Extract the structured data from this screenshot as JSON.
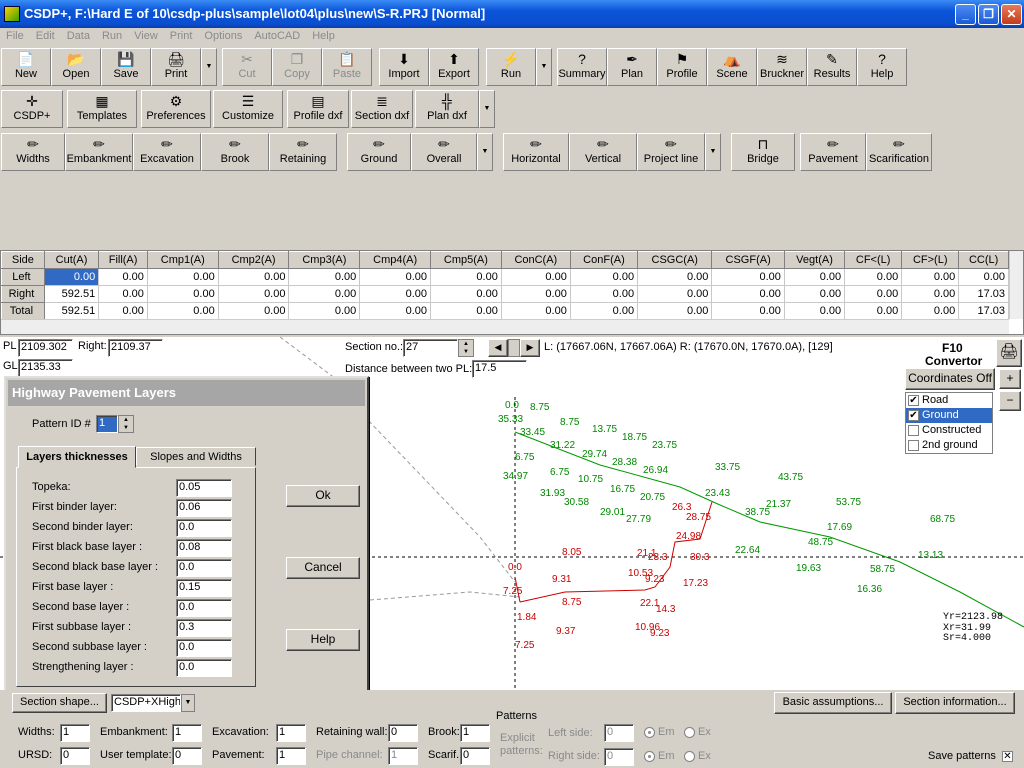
{
  "window": {
    "title": "CSDP+, F:\\Hard E of 10\\csdp-plus\\sample\\lot04\\plus\\new\\S-R.PRJ [Normal]"
  },
  "menu": [
    "File",
    "Edit",
    "Data",
    "Run",
    "View",
    "Print",
    "Options",
    "AutoCAD",
    "Help"
  ],
  "toolbar1": [
    {
      "label": "New",
      "icon": "📄"
    },
    {
      "label": "Open",
      "icon": "📂"
    },
    {
      "label": "Save",
      "icon": "💾"
    },
    {
      "label": "Print",
      "icon": "🖨"
    },
    {
      "label": "Cut",
      "icon": "✂"
    },
    {
      "label": "Copy",
      "icon": "❐"
    },
    {
      "label": "Paste",
      "icon": "📋"
    },
    {
      "label": "Import",
      "icon": "⬇"
    },
    {
      "label": "Export",
      "icon": "⬆"
    },
    {
      "label": "Run",
      "icon": "⚡"
    },
    {
      "label": "Summary",
      "icon": "?"
    },
    {
      "label": "Plan",
      "icon": "✒"
    },
    {
      "label": "Profile",
      "icon": "⚑"
    },
    {
      "label": "Scene",
      "icon": "⛺"
    },
    {
      "label": "Bruckner",
      "icon": "≋"
    },
    {
      "label": "Results",
      "icon": "✎"
    },
    {
      "label": "Help",
      "icon": "?"
    }
  ],
  "toolbar2": [
    {
      "label": "CSDP+",
      "icon": "✛"
    },
    {
      "label": "Templates",
      "icon": "▦"
    },
    {
      "label": "Preferences",
      "icon": "⚙"
    },
    {
      "label": "Customize",
      "icon": "☰"
    },
    {
      "label": "Profile dxf",
      "icon": "▤"
    },
    {
      "label": "Section dxf",
      "icon": "≣"
    },
    {
      "label": "Plan dxf",
      "icon": "╬"
    }
  ],
  "toolbar3": [
    {
      "label": "Widths",
      "icon": "✏"
    },
    {
      "label": "Embankment",
      "icon": "✏"
    },
    {
      "label": "Excavation",
      "icon": "✏"
    },
    {
      "label": "Brook",
      "icon": "✏"
    },
    {
      "label": "Retaining",
      "icon": "✏"
    },
    {
      "label": "Ground",
      "icon": "✏"
    },
    {
      "label": "Overall",
      "icon": "✏"
    },
    {
      "label": "Horizontal",
      "icon": "✏"
    },
    {
      "label": "Vertical",
      "icon": "✏"
    },
    {
      "label": "Project line",
      "icon": "✏"
    },
    {
      "label": "Bridge",
      "icon": "⊓"
    },
    {
      "label": "Pavement",
      "icon": "✏"
    },
    {
      "label": "Scarification",
      "icon": "✏"
    }
  ],
  "grid": {
    "headers": [
      "Side",
      "Cut(A)",
      "Fill(A)",
      "Cmp1(A)",
      "Cmp2(A)",
      "Cmp3(A)",
      "Cmp4(A)",
      "Cmp5(A)",
      "ConC(A)",
      "ConF(A)",
      "CSGC(A)",
      "CSGF(A)",
      "Vegt(A)",
      "CF<(L)",
      "CF>(L)",
      "CC(L)"
    ],
    "rows": [
      [
        "Left",
        "0.00",
        "0.00",
        "0.00",
        "0.00",
        "0.00",
        "0.00",
        "0.00",
        "0.00",
        "0.00",
        "0.00",
        "0.00",
        "0.00",
        "0.00",
        "0.00",
        "0.00"
      ],
      [
        "Right",
        "592.51",
        "0.00",
        "0.00",
        "0.00",
        "0.00",
        "0.00",
        "0.00",
        "0.00",
        "0.00",
        "0.00",
        "0.00",
        "0.00",
        "0.00",
        "0.00",
        "17.03"
      ],
      [
        "Total",
        "592.51",
        "0.00",
        "0.00",
        "0.00",
        "0.00",
        "0.00",
        "0.00",
        "0.00",
        "0.00",
        "0.00",
        "0.00",
        "0.00",
        "0.00",
        "0.00",
        "17.03"
      ]
    ]
  },
  "section": {
    "pl_label": "PL",
    "pl_value": "2109.302",
    "right_label": "Right:",
    "right_value": "2109.37",
    "gl_label": "GL",
    "gl_value": "2135.33",
    "section_no_label": "Section no.:",
    "section_no": "27",
    "dist_label": "Distance between two PL:",
    "dist_value": "17.5",
    "coords": "L: (17667.06N, 17667.06A) R: (17670.0N, 17670.0A), [129]",
    "f10": "F10",
    "convertor": "Convertor",
    "coords_btn": "Coordinates Off",
    "layers": [
      {
        "label": "Road",
        "checked": true
      },
      {
        "label": "Ground",
        "checked": true,
        "selected": true
      },
      {
        "label": "Constructed",
        "checked": false
      },
      {
        "label": "2nd ground",
        "checked": false
      }
    ],
    "info": [
      "Yr=2123.98",
      "Xr=31.99",
      "Sr=4.000"
    ]
  },
  "dialog": {
    "title": "Highway Pavement Layers",
    "pattern_label": "Pattern ID #",
    "pattern_value": "1",
    "tab1": "Layers thicknesses",
    "tab2": "Slopes and Widths",
    "layers": [
      {
        "label": "Topeka:",
        "value": "0.05"
      },
      {
        "label": "First binder layer:",
        "value": "0.06"
      },
      {
        "label": "Second binder layer:",
        "value": "0.0"
      },
      {
        "label": "First black base layer :",
        "value": "0.08"
      },
      {
        "label": "Second black base layer :",
        "value": "0.0"
      },
      {
        "label": "First base layer :",
        "value": "0.15"
      },
      {
        "label": "Second base layer :",
        "value": "0.0"
      },
      {
        "label": "First subbase layer :",
        "value": "0.3"
      },
      {
        "label": "Second subbase layer :",
        "value": "0.0"
      },
      {
        "label": "Strengthening layer :",
        "value": "0.0"
      }
    ],
    "ok": "Ok",
    "cancel": "Cancel",
    "help": "Help"
  },
  "bottom": {
    "section_shape": "Section shape...",
    "template_select": "CSDP+XHigh",
    "basic": "Basic assumptions...",
    "section_info": "Section information...",
    "patterns": "Patterns",
    "explicit": "Explicit patterns:",
    "left_side": "Left side:",
    "right_side": "Right side:",
    "left_val": "0",
    "right_val": "0",
    "em": "Em",
    "ex": "Ex",
    "save_patterns": "Save patterns",
    "fields1": [
      {
        "label": "Widths:",
        "value": "1"
      },
      {
        "label": "Embankment:",
        "value": "1"
      },
      {
        "label": "Excavation:",
        "value": "1"
      },
      {
        "label": "Retaining wall:",
        "value": "0"
      },
      {
        "label": "Brook:",
        "value": "1"
      }
    ],
    "fields2": [
      {
        "label": "URSD:",
        "value": "0"
      },
      {
        "label": "User template:",
        "value": "0"
      },
      {
        "label": "Pavement:",
        "value": "1"
      },
      {
        "label": "Pipe channel:",
        "value": "1"
      },
      {
        "label": "Scarif.:",
        "value": "0"
      }
    ]
  },
  "profile_labels": {
    "green": [
      [
        "0.0",
        505,
        408
      ],
      [
        "8.75",
        530,
        410
      ],
      [
        "35.33",
        498,
        422
      ],
      [
        "33.45",
        520,
        435
      ],
      [
        "8.75",
        560,
        425
      ],
      [
        "31.22",
        550,
        448
      ],
      [
        "13.75",
        592,
        432
      ],
      [
        "29.74",
        582,
        457
      ],
      [
        "18.75",
        622,
        440
      ],
      [
        "28.38",
        612,
        465
      ],
      [
        "23.75",
        652,
        448
      ],
      [
        "26.94",
        643,
        473
      ],
      [
        "6.75",
        515,
        460
      ],
      [
        "34.97",
        503,
        479
      ],
      [
        "6.75",
        550,
        475
      ],
      [
        "31.93",
        540,
        496
      ],
      [
        "10.75",
        578,
        482
      ],
      [
        "30.58",
        564,
        505
      ],
      [
        "16.75",
        610,
        492
      ],
      [
        "29.01",
        600,
        515
      ],
      [
        "20.75",
        640,
        500
      ],
      [
        "27.79",
        626,
        522
      ],
      [
        "33.75",
        715,
        470
      ],
      [
        "23.43",
        705,
        496
      ],
      [
        "43.75",
        778,
        480
      ],
      [
        "21.37",
        766,
        507
      ],
      [
        "38.75",
        745,
        515
      ],
      [
        "22.64",
        735,
        553
      ],
      [
        "53.75",
        836,
        505
      ],
      [
        "17.69",
        827,
        530
      ],
      [
        "48.75",
        808,
        545
      ],
      [
        "19.63",
        796,
        571
      ],
      [
        "58.75",
        870,
        572
      ],
      [
        "16.36",
        857,
        592
      ],
      [
        "68.75",
        930,
        522
      ],
      [
        "13.13",
        918,
        558
      ]
    ],
    "red": [
      [
        "26.3",
        672,
        510
      ],
      [
        "24.98",
        676,
        539
      ],
      [
        "28.75",
        686,
        520
      ],
      [
        "8.05",
        562,
        555
      ],
      [
        "9.31",
        552,
        582
      ],
      [
        "21.1",
        637,
        556
      ],
      [
        "10.53",
        628,
        576
      ],
      [
        "23.3",
        648,
        560
      ],
      [
        "9.23",
        645,
        582
      ],
      [
        "30.3",
        690,
        560
      ],
      [
        "17.23",
        683,
        586
      ],
      [
        "0.0",
        508,
        570
      ],
      [
        "7.25",
        503,
        594
      ],
      [
        "8.75",
        562,
        605
      ],
      [
        "9.37",
        556,
        634
      ],
      [
        "22.1",
        640,
        606
      ],
      [
        "10.96",
        635,
        630
      ],
      [
        "14.3",
        656,
        612
      ],
      [
        "9.23",
        650,
        636
      ],
      [
        "1.84",
        517,
        620
      ],
      [
        "7.25",
        515,
        648
      ]
    ]
  }
}
